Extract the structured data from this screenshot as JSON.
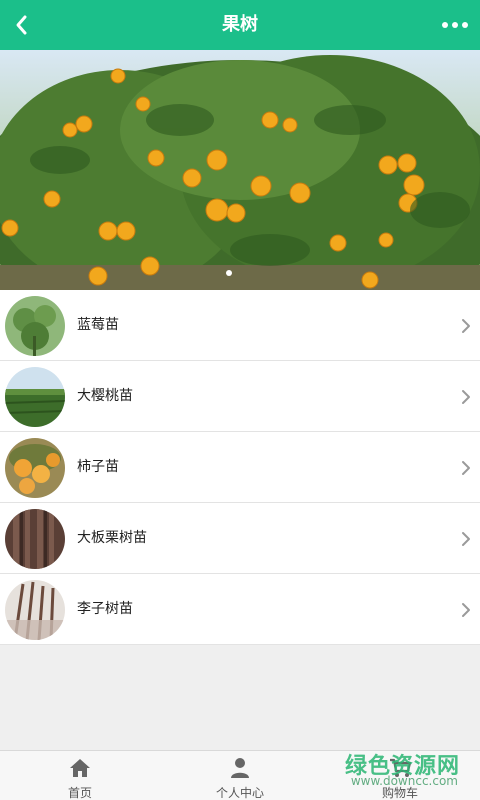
{
  "header": {
    "title": "果树",
    "back_icon": "chevron-left-icon",
    "more_icon": "more-dots-icon",
    "bg_color": "#1bbf8a"
  },
  "banner": {
    "image": "orange-tree-photo",
    "page_indicator": {
      "count": 1,
      "active": 1
    }
  },
  "items": [
    {
      "label": "蓝莓苗",
      "thumb": "blueberry-seedling-photo"
    },
    {
      "label": "大樱桃苗",
      "thumb": "cherry-orchard-photo"
    },
    {
      "label": "柿子苗",
      "thumb": "persimmon-photo"
    },
    {
      "label": "大板栗树苗",
      "thumb": "chestnut-seedling-photo"
    },
    {
      "label": "李子树苗",
      "thumb": "plum-seedling-photo"
    }
  ],
  "tabbar": {
    "tabs": [
      {
        "label": "首页",
        "icon": "home-icon"
      },
      {
        "label": "个人中心",
        "icon": "user-icon"
      },
      {
        "label": "购物车",
        "icon": "cart-icon"
      }
    ]
  },
  "watermark": {
    "line1": "绿色资源网",
    "line2": "www.downcc.com"
  }
}
